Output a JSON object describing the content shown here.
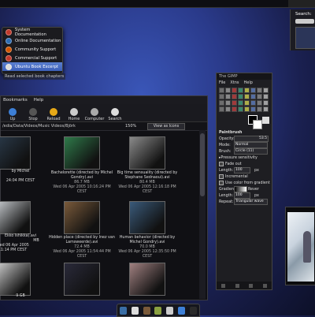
{
  "help_menu": {
    "items": [
      {
        "label": "System Documentation",
        "color": "#c0392b"
      },
      {
        "label": "Online Documentation",
        "color": "#2e6db4"
      },
      {
        "label": "Community Support",
        "color": "#d35400"
      },
      {
        "label": "Commercial Support",
        "color": "#c0392b"
      },
      {
        "label": "Ubuntu Book Excerpt",
        "color": "#dddddd"
      }
    ],
    "tooltip": "Read selected book chapters"
  },
  "search_panel": {
    "label": "Search:"
  },
  "file_manager": {
    "menus": [
      "Bookmarks",
      "Help"
    ],
    "toolbar": [
      {
        "label": "Up",
        "icon": "up-arrow-icon",
        "color": "#3d7fd6"
      },
      {
        "label": "Stop",
        "icon": "stop-icon",
        "color": "#555555"
      },
      {
        "label": "Reload",
        "icon": "reload-icon",
        "color": "#e6a817"
      },
      {
        "label": "Home",
        "icon": "home-icon",
        "color": "#cccccc"
      },
      {
        "label": "Computer",
        "icon": "computer-icon",
        "color": "#aaaaaa"
      },
      {
        "label": "Search",
        "icon": "search-icon",
        "color": "#dddddd"
      }
    ],
    "path": "/edia/Data/Videos/Music Videos/Björk",
    "zoom": "150%",
    "view_mode": "View as Icons",
    "files": [
      {
        "name": "",
        "size": "",
        "date": "",
        "thumb": "#2a3a4a"
      },
      {
        "name": "Bachelorette (directed by Michel Gondry).avi",
        "size": "86.7 MB",
        "date": "Wed 06 Apr 2005 10:16:24 PM CEST",
        "thumb": "#2f7a4a"
      },
      {
        "name": "Big time sensuality (directed by Stephane Sednaoui).avi",
        "size": "80.4 MB",
        "date": "Wed 06 Apr 2005 12:16:18 PM CEST",
        "thumb": "#8a8a8a"
      },
      {
        "name": "",
        "size": "",
        "date": "",
        "thumb": "#c8ccd0"
      },
      {
        "name": "Hidden place (directed by Inez van Lamsweerde).avi",
        "size": "72.4 MB",
        "date": "Wed 06 Apr 2005 11:54:44 PM CEST",
        "thumb": "#7a5a3a"
      },
      {
        "name": "Human behavior (directed by Michel Gondry).avi",
        "size": "70.0 MB",
        "date": "Wed 06 Apr 2005 12:35:50 PM CEST",
        "thumb": "#3a5a7a"
      },
      {
        "name": "",
        "size": "",
        "date": "",
        "thumb": "#d0d0d0"
      },
      {
        "name": "",
        "size": "",
        "date": "",
        "thumb": "#2a2a3a"
      },
      {
        "name": "",
        "size": "",
        "date": "",
        "thumb": "#a08080"
      }
    ],
    "partial_labels": {
      "row1_name_tail": "by Michel",
      "row1_date_tail": "24:04 PM CEST",
      "row2_name_tail": "Ekko Ishikka).avi",
      "row2_date_tail": "Wed 06 Apr 2005 11:14 PM CEST",
      "row2_size": "MB",
      "row3_tail": "9 GB"
    }
  },
  "gimp": {
    "title": "The GIMP",
    "menus": [
      "File",
      "Xtns",
      "Help"
    ],
    "tool_name": "Paintbrush",
    "opacity_label": "Opacity:",
    "opacity_value": "53.5",
    "mode_label": "Mode:",
    "mode_value": "Normal",
    "brush_label": "Brush:",
    "brush_value": "Circle (11)",
    "pressure": "Pressure sensitivity",
    "fade_out": "Fade out",
    "length_label": "Length:",
    "length_value": "100",
    "unit": "px",
    "incremental": "Incremental",
    "use_gradient": "Use color from gradient",
    "gradient_label": "Gradient:",
    "reverse": "Rever",
    "length2_value": "100",
    "repeat_label": "Repeat:",
    "repeat_value": "Triangular wave"
  },
  "dock_colors": [
    "#3a6ea5",
    "#dddddd",
    "#7a5a3a",
    "#8aa040",
    "#cccccc",
    "#3d7fd6",
    "#2a2a2a"
  ]
}
